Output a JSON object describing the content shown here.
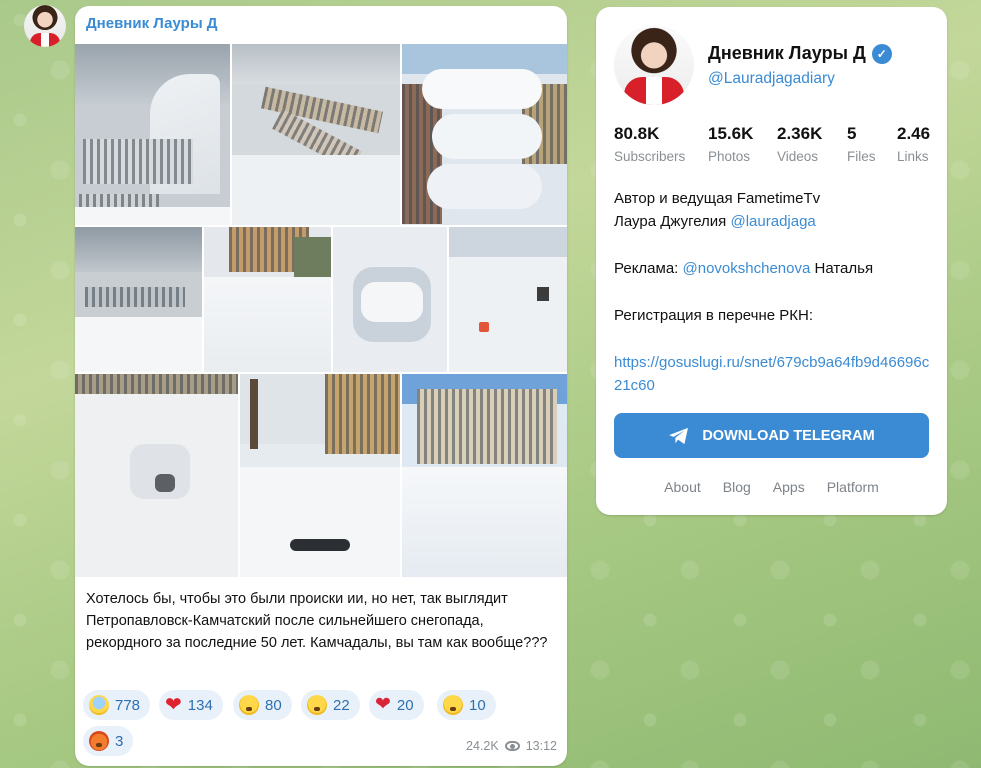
{
  "post": {
    "channel_title": "Дневник Лауры Д",
    "caption": "Хотелось бы, чтобы это были происки ии, но нет, так выглядит Петропавловск-Камчатский после сильнейшего снегопада, рекордного за последние 50 лет. Камчадалы, вы там как вообще???",
    "views": "24.2K",
    "time": "13:12",
    "reactions": [
      {
        "icon": "screaming-face-icon",
        "count": "778"
      },
      {
        "icon": "red-heart-icon",
        "count": "134"
      },
      {
        "icon": "exploding-head-icon",
        "count": "80"
      },
      {
        "icon": "rofl-face-icon",
        "count": "22"
      },
      {
        "icon": "broken-heart-icon",
        "count": "20"
      },
      {
        "icon": "thinking-face-icon",
        "count": "10"
      },
      {
        "icon": "cursing-face-icon",
        "count": "3"
      }
    ]
  },
  "channel": {
    "name": "Дневник Лауры Д",
    "handle": "@Lauradjagadiary",
    "stats": [
      {
        "value": "80.8K",
        "label": "Subscribers"
      },
      {
        "value": "15.6K",
        "label": "Photos"
      },
      {
        "value": "2.36K",
        "label": "Videos"
      },
      {
        "value": "5",
        "label": "Files"
      },
      {
        "value": "2.46",
        "label": "Links"
      }
    ],
    "desc_line1": "Автор и ведущая FametimeTv",
    "desc_line2_prefix": "Лаура Джугелия ",
    "desc_line2_link": "@lauradjaga",
    "ad_prefix": "Реклама: ",
    "ad_link": "@novokshchenova",
    "ad_suffix": " Наталья",
    "rkn": "Регистрация в перечне РКН:",
    "rkn_link": "https://gosuslugi.ru/snet/679cb9a64fb9d46696c21c60",
    "download_label": "DOWNLOAD TELEGRAM",
    "footer": [
      "About",
      "Blog",
      "Apps",
      "Platform"
    ]
  },
  "colors": {
    "accent": "#3a8bd3",
    "reaction_bg": "#e8f1fa",
    "muted": "#8a8f94"
  }
}
